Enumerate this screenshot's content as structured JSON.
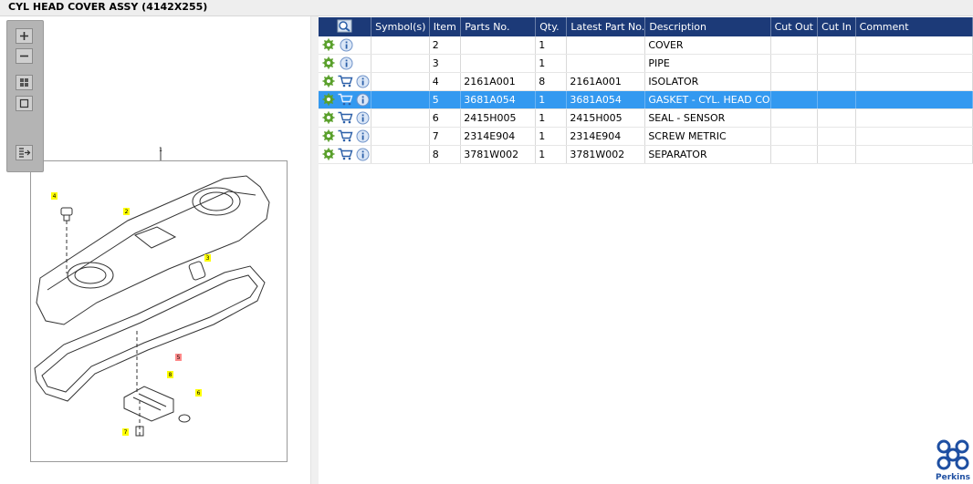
{
  "window": {
    "title": "CYL HEAD COVER ASSY (4142X255)"
  },
  "toolbar": {
    "buttons": [
      {
        "name": "zoom-in",
        "icon": "plus-icon"
      },
      {
        "name": "zoom-out",
        "icon": "minus-icon"
      },
      {
        "name": "fit-all",
        "icon": "fit-grid-icon"
      },
      {
        "name": "actual-size",
        "icon": "square-icon"
      },
      {
        "name": "export-list",
        "icon": "list-arrow-icon"
      }
    ]
  },
  "drawing": {
    "callouts": [
      "1",
      "2",
      "3",
      "4",
      "5",
      "6",
      "7",
      "8"
    ]
  },
  "grid": {
    "columns": [
      "Symbol(s)",
      "Item",
      "Parts No.",
      "Qty.",
      "Latest Part No.",
      "Description",
      "Cut Out",
      "Cut In",
      "Comment"
    ],
    "rows": [
      {
        "item": "2",
        "parts_no": "",
        "qty": "1",
        "latest": "",
        "description": "COVER",
        "cart": false,
        "selected": false
      },
      {
        "item": "3",
        "parts_no": "",
        "qty": "1",
        "latest": "",
        "description": "PIPE",
        "cart": false,
        "selected": false
      },
      {
        "item": "4",
        "parts_no": "2161A001",
        "qty": "8",
        "latest": "2161A001",
        "description": "ISOLATOR",
        "cart": true,
        "selected": false
      },
      {
        "item": "5",
        "parts_no": "3681A054",
        "qty": "1",
        "latest": "3681A054",
        "description": "GASKET - CYL. HEAD CO",
        "cart": true,
        "selected": true
      },
      {
        "item": "6",
        "parts_no": "2415H005",
        "qty": "1",
        "latest": "2415H005",
        "description": "SEAL - SENSOR",
        "cart": true,
        "selected": false
      },
      {
        "item": "7",
        "parts_no": "2314E904",
        "qty": "1",
        "latest": "2314E904",
        "description": "SCREW METRIC",
        "cart": true,
        "selected": false
      },
      {
        "item": "8",
        "parts_no": "3781W002",
        "qty": "1",
        "latest": "3781W002",
        "description": "SEPARATOR",
        "cart": true,
        "selected": false
      }
    ]
  },
  "brand": {
    "name": "Perkins",
    "color": "#1e4fa2"
  },
  "colors": {
    "header": "#1c3a78",
    "selection": "#3399f0",
    "callout_yellow": "#ffff00",
    "callout_red": "#ff8a8a"
  }
}
